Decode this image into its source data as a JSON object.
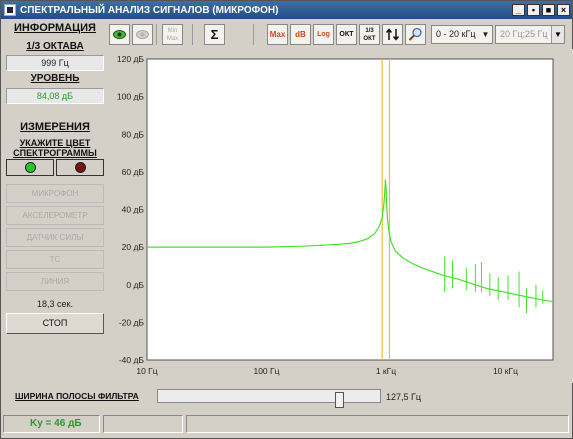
{
  "window": {
    "title": "СПЕКТРАЛЬНЫЙ АНАЛИЗ СИГНАЛОВ  (МИКРОФОН)",
    "buttons": [
      "_",
      "▪",
      "■",
      "×"
    ]
  },
  "left_panel": {
    "info_title": "ИНФОРМАЦИЯ",
    "octave_title": "1/3 ОКТАВА",
    "octave_value": "999 Гц",
    "level_title": "УРОВЕНЬ",
    "level_value": "84,08 дБ",
    "measure_title": "ИЗМЕРЕНИЯ",
    "color_prompt": "УКАЖИТЕ ЦВЕТ СПЕКТРОГРАММЫ",
    "color_options": [
      {
        "name": "green",
        "color": "#22c922"
      },
      {
        "name": "red",
        "color": "#7a1010"
      }
    ],
    "sources": [
      "МИКРОФОН",
      "АКСЕЛЕРОМЕТР",
      "ДАТЧИК СИЛЫ",
      "ТС",
      "ЛИНИЯ"
    ],
    "elapsed": "18,3 сек.",
    "stop_label": "СТОП"
  },
  "toolbar": {
    "minmax_label": "Min Max",
    "sum_label": "Σ",
    "max_label": "Max",
    "db_label": "dB",
    "log_label": "Log",
    "okt_label": "ОКТ",
    "okt3_label": "1/3 ОКТ",
    "range_select": "0 - 20 кГц",
    "resolution_select": "20 Гц;25 Гц"
  },
  "chart_data": {
    "type": "line",
    "xscale": "log",
    "xlim": [
      10,
      25000
    ],
    "ylim": [
      -40,
      120
    ],
    "x_ticks": [
      10,
      100,
      1000,
      10000
    ],
    "x_tick_labels": [
      "10 Гц",
      "100 Гц",
      "1 кГц",
      "10 кГц"
    ],
    "y_ticks": [
      120,
      100,
      80,
      60,
      40,
      20,
      0,
      -20,
      -40
    ],
    "y_tick_labels": [
      "120 дБ",
      "100 дБ",
      "80 дБ",
      "60 дБ",
      "40 дБ",
      "20 дБ",
      "0 дБ",
      "-20 дБ",
      "-40 дБ"
    ],
    "grid": false,
    "series": [
      {
        "color": "#44e22a",
        "x": [
          10,
          20,
          50,
          100,
          200,
          300,
          400,
          500,
          600,
          700,
          800,
          880,
          930,
          960,
          980,
          990,
          1000,
          1010,
          1030,
          1060,
          1100,
          1200,
          1400,
          1700,
          2000,
          3000,
          4000,
          5000,
          7000,
          10000,
          14000,
          20000,
          25000
        ],
        "y": [
          20,
          20,
          20,
          20,
          20.5,
          21,
          21.5,
          22,
          23,
          24.5,
          27,
          31,
          36,
          43,
          50,
          56,
          52,
          44,
          35,
          28,
          23,
          18,
          14,
          11,
          9,
          5,
          3,
          1,
          -2,
          -4,
          -6,
          -8,
          -9
        ]
      }
    ],
    "spikes": [
      {
        "x": 3100,
        "top": 15,
        "bottom": -4
      },
      {
        "x": 3600,
        "top": 13,
        "bottom": -2
      },
      {
        "x": 4700,
        "top": 9,
        "bottom": -3
      },
      {
        "x": 5600,
        "top": 11,
        "bottom": -4
      },
      {
        "x": 6300,
        "top": 12,
        "bottom": -4
      },
      {
        "x": 7400,
        "top": 6,
        "bottom": -6
      },
      {
        "x": 8700,
        "top": 4,
        "bottom": -8
      },
      {
        "x": 10500,
        "top": 5,
        "bottom": -8
      },
      {
        "x": 13000,
        "top": 7,
        "bottom": -12
      },
      {
        "x": 15000,
        "top": -2,
        "bottom": -15
      },
      {
        "x": 18000,
        "top": 0,
        "bottom": -12
      },
      {
        "x": 20500,
        "top": -3,
        "bottom": -10
      }
    ],
    "markers": {
      "color": "#e8c23a",
      "x": [
        930,
        1070
      ]
    }
  },
  "filter": {
    "label": "ШИРИНА ПОЛОСЫ ФИЛЬТРА",
    "value_text": "127,5 Гц",
    "position_fraction": 0.83
  },
  "status": {
    "ky": "Ky = 46 дБ"
  }
}
